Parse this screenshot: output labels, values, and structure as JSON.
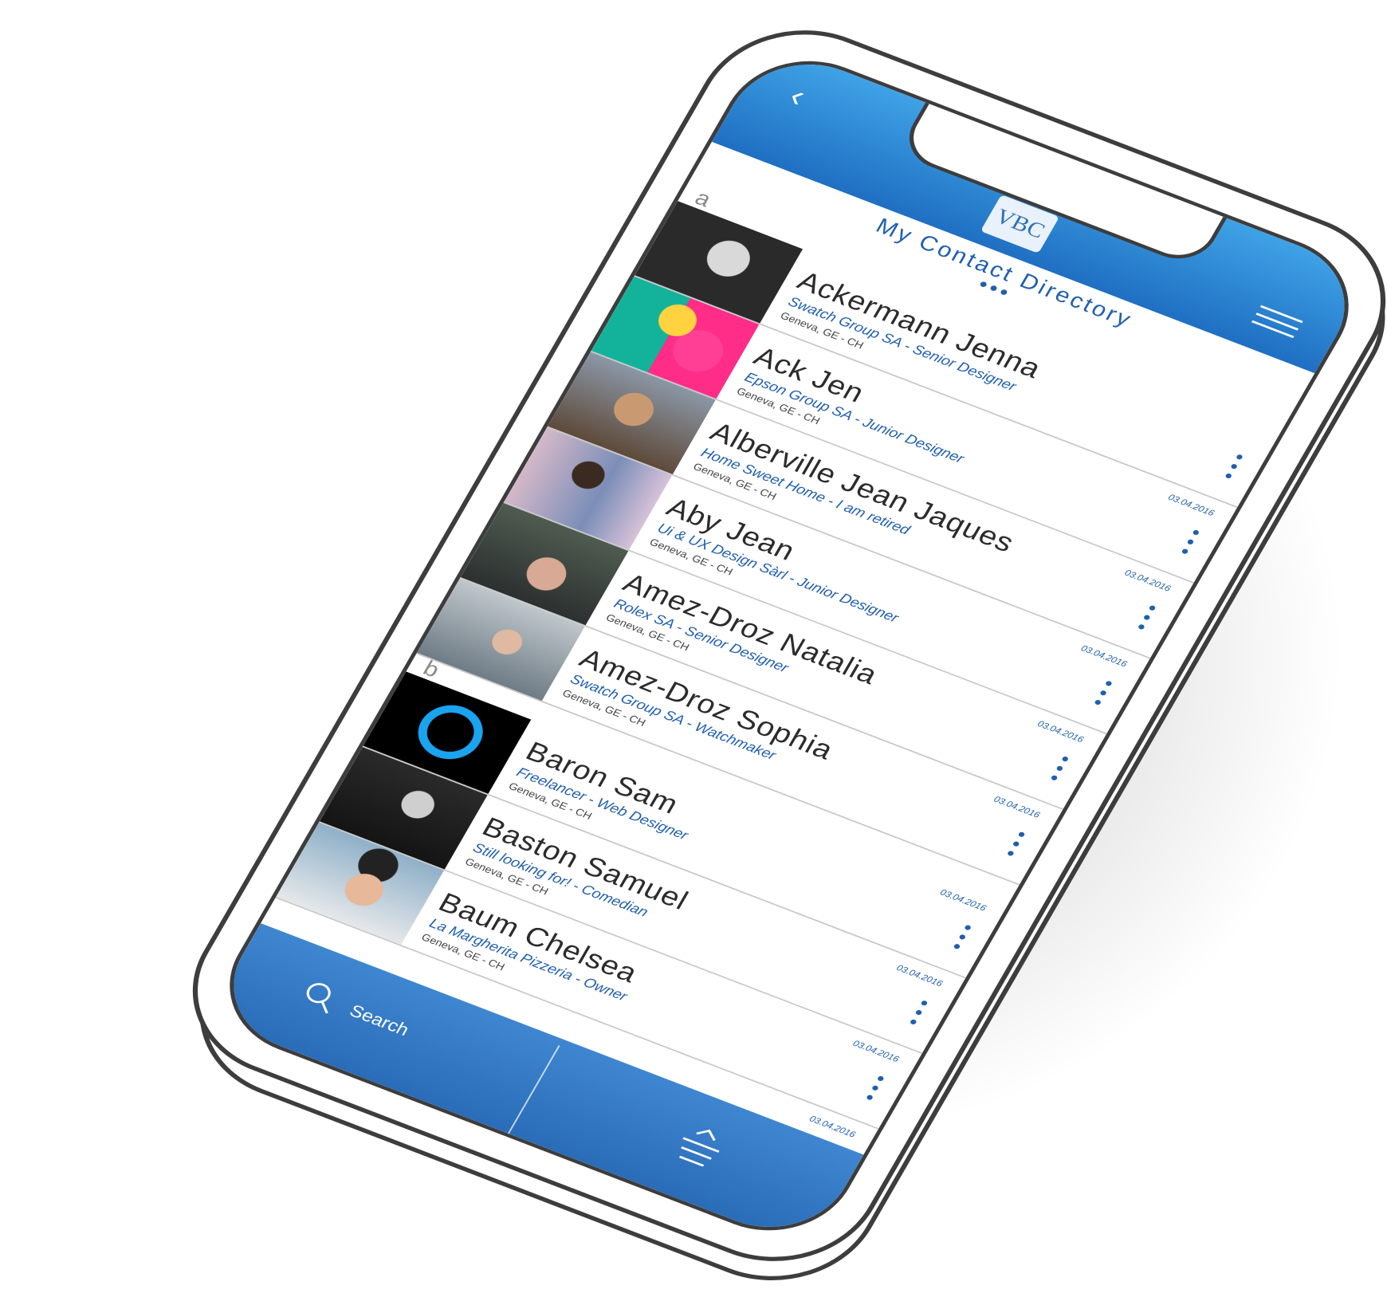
{
  "header": {
    "logo_text": "VBC",
    "back_glyph": "‹",
    "title": "My Contact Directory",
    "title_dots": "•••"
  },
  "sections": [
    {
      "letter": "a"
    },
    {
      "letter": "b"
    }
  ],
  "contacts": [
    {
      "name": "Ackermann Jenna",
      "company": "Swatch Group SA - Senior Designer",
      "location": "Geneva, GE - CH",
      "date": "",
      "avatar": "portrait-woman-bw"
    },
    {
      "name": "Ack Jen",
      "company": "Epson Group SA - Junior Designer",
      "location": "Geneva, GE - CH",
      "date": "03.04.2016",
      "avatar": "person-with-emoji-balloons"
    },
    {
      "name": "Alberville Jean Jaques",
      "company": "Home Sweet Home - I am retired",
      "location": "Geneva, GE - CH",
      "date": "03.04.2016",
      "avatar": "portrait-older-man"
    },
    {
      "name": "Aby Jean",
      "company": "Ui & UX Design Sàrl - Junior Designer",
      "location": "Geneva, GE - CH",
      "date": "03.04.2016",
      "avatar": "portrait-man-sunglasses"
    },
    {
      "name": "Amez-Droz Natalia",
      "company": "Rolex SA - Senior Designer",
      "location": "Geneva, GE - CH",
      "date": "03.04.2016",
      "avatar": "portrait-woman-knit-hat"
    },
    {
      "name": "Amez-Droz Sophia",
      "company": "Swatch Group SA - Watchmaker",
      "location": "Geneva, GE - CH",
      "date": "03.04.2016",
      "avatar": "portrait-woman-seaside"
    },
    {
      "name": "Baron Sam",
      "company": "Freelancer - Web Designer",
      "location": "Geneva, GE - CH",
      "date": "03.04.2016",
      "avatar": "silhouette-placeholder"
    },
    {
      "name": "Baston Samuel",
      "company": "Still looking for! - Comedian",
      "location": "Geneva, GE - CH",
      "date": "03.04.2016",
      "avatar": "portrait-man-bw"
    },
    {
      "name": "Baum Chelsea",
      "company": "La Margherita Pizzeria - Owner",
      "location": "Geneva, GE - CH",
      "date": "03.04.2016",
      "avatar": "portrait-woman-beanie"
    },
    {
      "name": "",
      "company": "",
      "location": "",
      "date": "03.04.2016",
      "avatar": ""
    }
  ],
  "footer": {
    "search_label": "Search",
    "search_icon": "search-icon",
    "sort_icon": "sort-up-icon"
  },
  "colors": {
    "primary": "#1f5fae",
    "header_top": "#3fa2e6",
    "header_bottom": "#1f6fc2",
    "footer": "#2a6cb8"
  }
}
